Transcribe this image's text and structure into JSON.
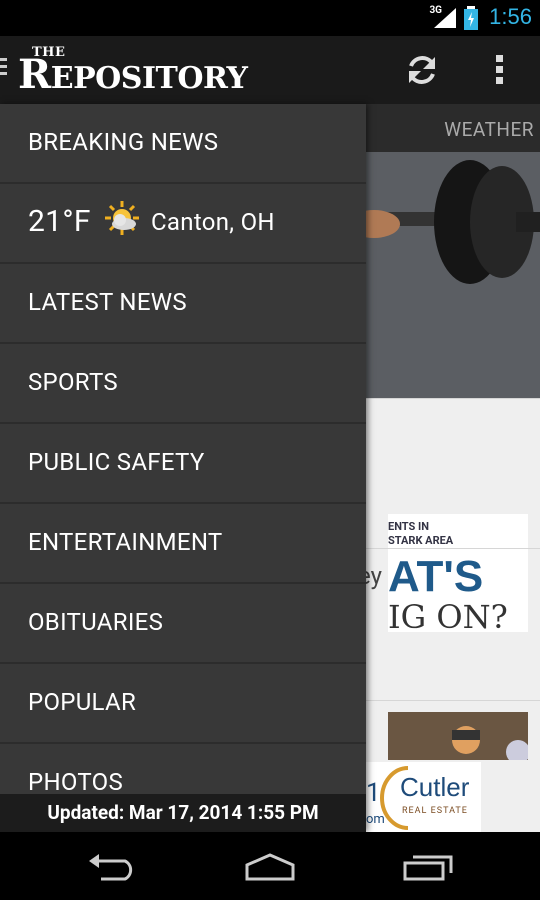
{
  "status_bar": {
    "network": "3G",
    "time": "1:56"
  },
  "action_bar": {
    "logo_the": "THE",
    "logo_name_first": "R",
    "logo_name_rest": "EPOSITORY",
    "refresh_icon": "refresh-icon",
    "overflow_icon": "overflow-menu-icon"
  },
  "background": {
    "tab_label": "WEATHER",
    "promo_line1": "ENTS IN",
    "promo_line2": "STARK AREA",
    "promo_big": "AT'S",
    "promo_sub": "IG ON?",
    "partial_text": "ey",
    "ad_number": "1",
    "ad_brand": "Cutler",
    "ad_tag": "REAL ESTATE",
    "ad_domain": "om"
  },
  "drawer": {
    "items": [
      {
        "label": "BREAKING NEWS"
      },
      {
        "label": "LATEST NEWS"
      },
      {
        "label": "SPORTS"
      },
      {
        "label": "PUBLIC SAFETY"
      },
      {
        "label": "ENTERTAINMENT"
      },
      {
        "label": "OBITUARIES"
      },
      {
        "label": "POPULAR"
      },
      {
        "label": "PHOTOS"
      }
    ],
    "weather": {
      "temp": "21°F",
      "icon": "partly-cloudy-icon",
      "city": "Canton, OH"
    },
    "updated": "Updated: Mar 17, 2014 1:55 PM"
  },
  "colors": {
    "accent": "#33b5e5",
    "drawer_bg": "#383838",
    "divider": "#2c2c2c"
  }
}
